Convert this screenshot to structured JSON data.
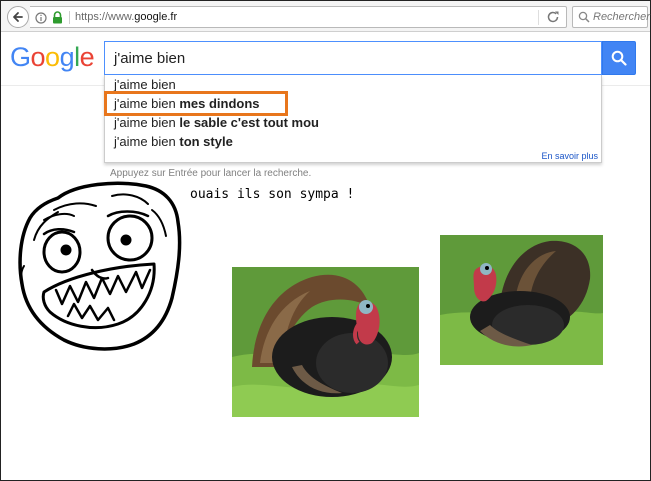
{
  "browser": {
    "url_prefix": "https://www.",
    "url_domain": "google.fr",
    "search_placeholder": "Rechercher"
  },
  "google": {
    "logo_letters": [
      "G",
      "o",
      "o",
      "g",
      "l",
      "e"
    ],
    "query": "j'aime bien",
    "suggestions": [
      {
        "prefix": "j'aime bien",
        "bold": ""
      },
      {
        "prefix": "j'aime bien ",
        "bold": "mes dindons"
      },
      {
        "prefix": "j'aime bien ",
        "bold": "le sable c'est tout mou"
      },
      {
        "prefix": "j'aime bien ",
        "bold": "ton style"
      }
    ],
    "learn_more": "En savoir plus",
    "hint": "Appuyez sur Entrée pour lancer la recherche."
  },
  "meme": {
    "caption": "ouais ils son sympa !"
  },
  "colors": {
    "google_blue": "#4285f4",
    "highlight_orange": "#e8761c",
    "link_blue": "#1a55c8"
  },
  "icons": [
    "back-arrow-icon",
    "info-icon",
    "lock-icon",
    "reload-icon",
    "search-icon"
  ]
}
